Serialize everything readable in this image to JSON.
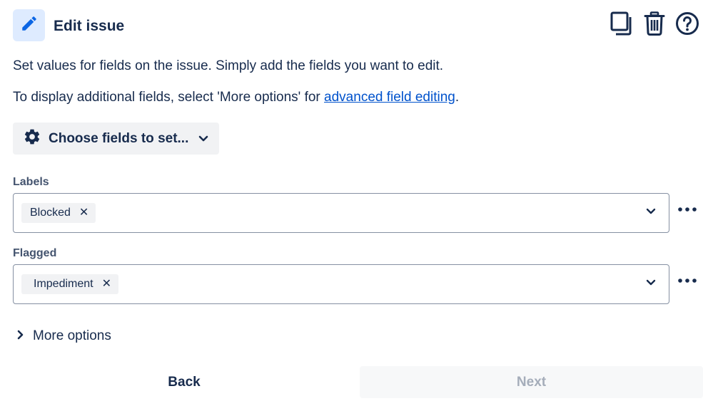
{
  "header": {
    "title": "Edit issue",
    "icon": "pencil-icon",
    "actions": [
      {
        "icon": "duplicate-icon"
      },
      {
        "icon": "trash-icon"
      },
      {
        "icon": "help-icon"
      }
    ]
  },
  "description": {
    "line1": "Set values for fields on the issue. Simply add the fields you want to edit.",
    "line2_prefix": "To display additional fields, select 'More options' for ",
    "line2_link": "advanced field editing",
    "line2_suffix": "."
  },
  "choose_fields": {
    "label": "Choose fields to set...",
    "icon": "gear-icon"
  },
  "fields": {
    "labels": {
      "label": "Labels",
      "tag": "Blocked"
    },
    "flagged": {
      "label": "Flagged",
      "tag": "Impediment"
    }
  },
  "more_options": {
    "label": "More options"
  },
  "footer": {
    "back_label": "Back",
    "next_label": "Next"
  },
  "colors": {
    "accent": "#0052cc",
    "icon_bg": "#deebff",
    "pencil": "#0c66e4",
    "text": "#172b4d",
    "disabled_text": "#a5adba"
  }
}
